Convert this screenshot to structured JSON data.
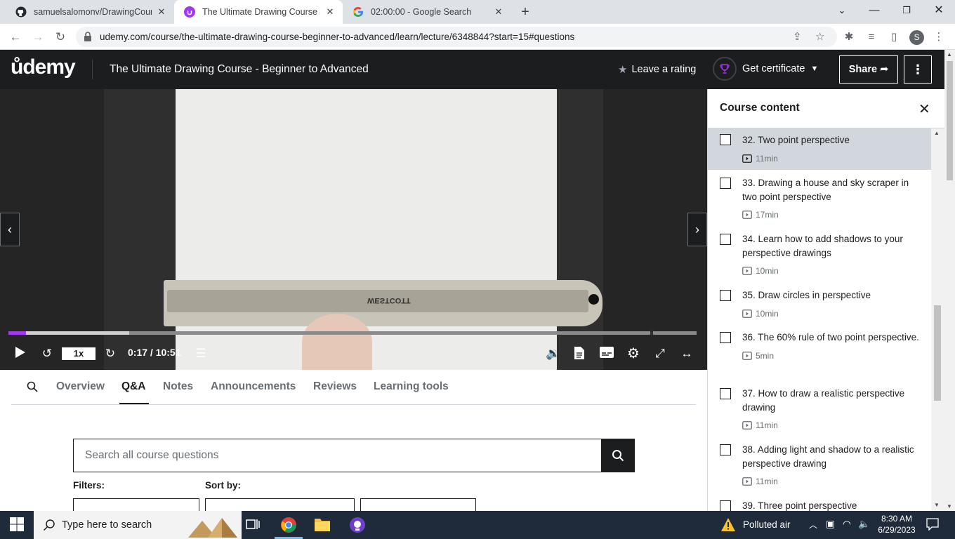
{
  "browser": {
    "tabs": [
      {
        "title": "samuelsalomonv/DrawingCourse",
        "icon": "github-icon"
      },
      {
        "title": "The Ultimate Drawing Course - B",
        "icon": "udemy-icon"
      },
      {
        "title": "02:00:00 - Google Search",
        "icon": "google-icon"
      }
    ],
    "url": "udemy.com/course/the-ultimate-drawing-course-beginner-to-advanced/learn/lecture/6348844?start=15#questions",
    "profile_initial": "S"
  },
  "header": {
    "logo": "ůdemy",
    "course_title": "The Ultimate Drawing Course - Beginner to Advanced",
    "rating_label": "Leave a rating",
    "certificate_label": "Get certificate",
    "share_label": "Share"
  },
  "player": {
    "speed": "1x",
    "time": "0:17 / 10:51",
    "progress_fraction": 0.026,
    "buffered_fraction": 0.175,
    "ruler_brand": "WESTCOTT"
  },
  "content_tabs": [
    "Overview",
    "Q&A",
    "Notes",
    "Announcements",
    "Reviews",
    "Learning tools"
  ],
  "active_tab": "Q&A",
  "qa": {
    "search_placeholder": "Search all course questions",
    "filters_label": "Filters:",
    "sort_label": "Sort by:"
  },
  "sidebar": {
    "title": "Course content",
    "lectures": [
      {
        "title": "32. Two point perspective",
        "duration": "11min",
        "current": true
      },
      {
        "title": "33. Drawing a house and sky scraper in two point perspective",
        "duration": "17min"
      },
      {
        "title": "34. Learn how to add shadows to your perspective drawings",
        "duration": "10min"
      },
      {
        "title": "35. Draw circles in perspective",
        "duration": "10min"
      },
      {
        "title": "36. The 60% rule of two point perspective.",
        "duration": "5min"
      },
      {
        "title": "37. How to draw a realistic perspective drawing",
        "duration": "11min"
      },
      {
        "title": "38. Adding light and shadow to a realistic perspective drawing",
        "duration": "11min"
      },
      {
        "title": "39. Three point perspective",
        "duration": ""
      }
    ]
  },
  "taskbar": {
    "search_placeholder": "Type here to search",
    "weather": "Polluted air",
    "time": "8:30 AM",
    "date": "6/29/2023"
  },
  "colors": {
    "udemy_dark": "#1c1d1f",
    "udemy_purple": "#a435f0",
    "chrome_tabbar": "#dee1e6"
  }
}
